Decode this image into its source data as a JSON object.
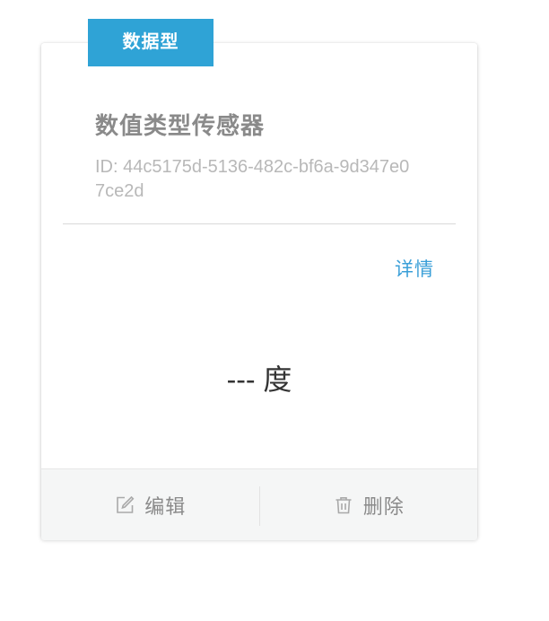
{
  "tag": {
    "label": "数据型",
    "color": "#2fa3d6"
  },
  "sensor": {
    "name": "数值类型传感器",
    "id": "ID: 44c5175d-5136-482c-bf6a-9d347e07ce2d"
  },
  "actions": {
    "detail_label": "详情",
    "edit_label": "编辑",
    "delete_label": "删除"
  },
  "reading": {
    "value": "---",
    "unit": "度"
  },
  "icons": {
    "edit": "edit-icon",
    "delete": "trash-icon"
  },
  "colors": {
    "accent": "#2fa3d6",
    "link": "#3a9fd8",
    "muted_text": "#8a8a8a"
  }
}
